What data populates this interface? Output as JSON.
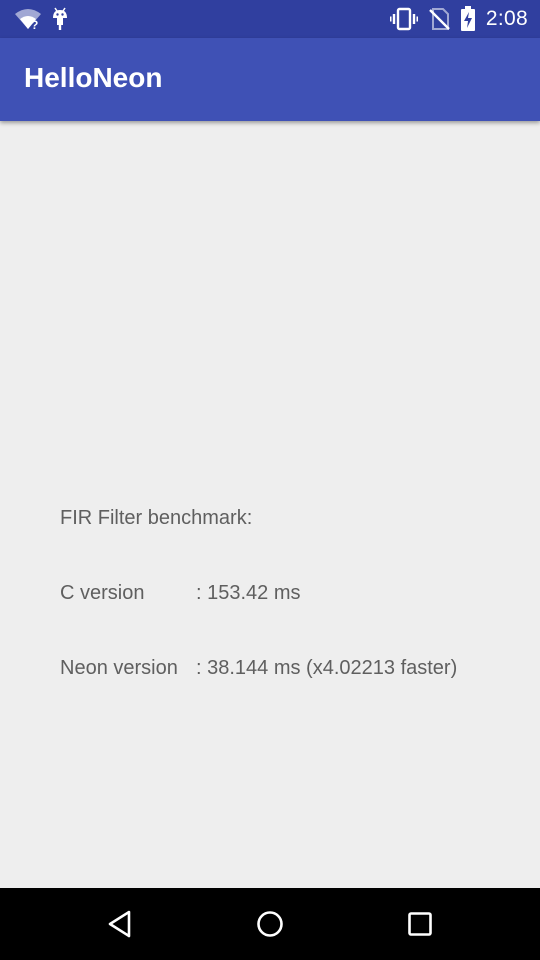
{
  "status_bar": {
    "time": "2:08",
    "icons": [
      "wifi-unknown-icon",
      "android-debug-icon",
      "vibrate-icon",
      "no-sim-icon",
      "battery-charging-icon"
    ]
  },
  "app_bar": {
    "title": "HelloNeon"
  },
  "benchmark": {
    "heading": "FIR Filter benchmark:",
    "c_label": "C version",
    "c_value": ": 153.42 ms",
    "neon_label": "Neon version",
    "neon_value": ": 38.144 ms (x4.02213 faster)"
  },
  "nav_bar": {
    "buttons": [
      "back-icon",
      "home-icon",
      "recents-icon"
    ]
  },
  "colors": {
    "status_bar": "#303f9f",
    "app_bar": "#3f51b5",
    "background": "#eeeeee",
    "text": "#5f5f5f"
  }
}
